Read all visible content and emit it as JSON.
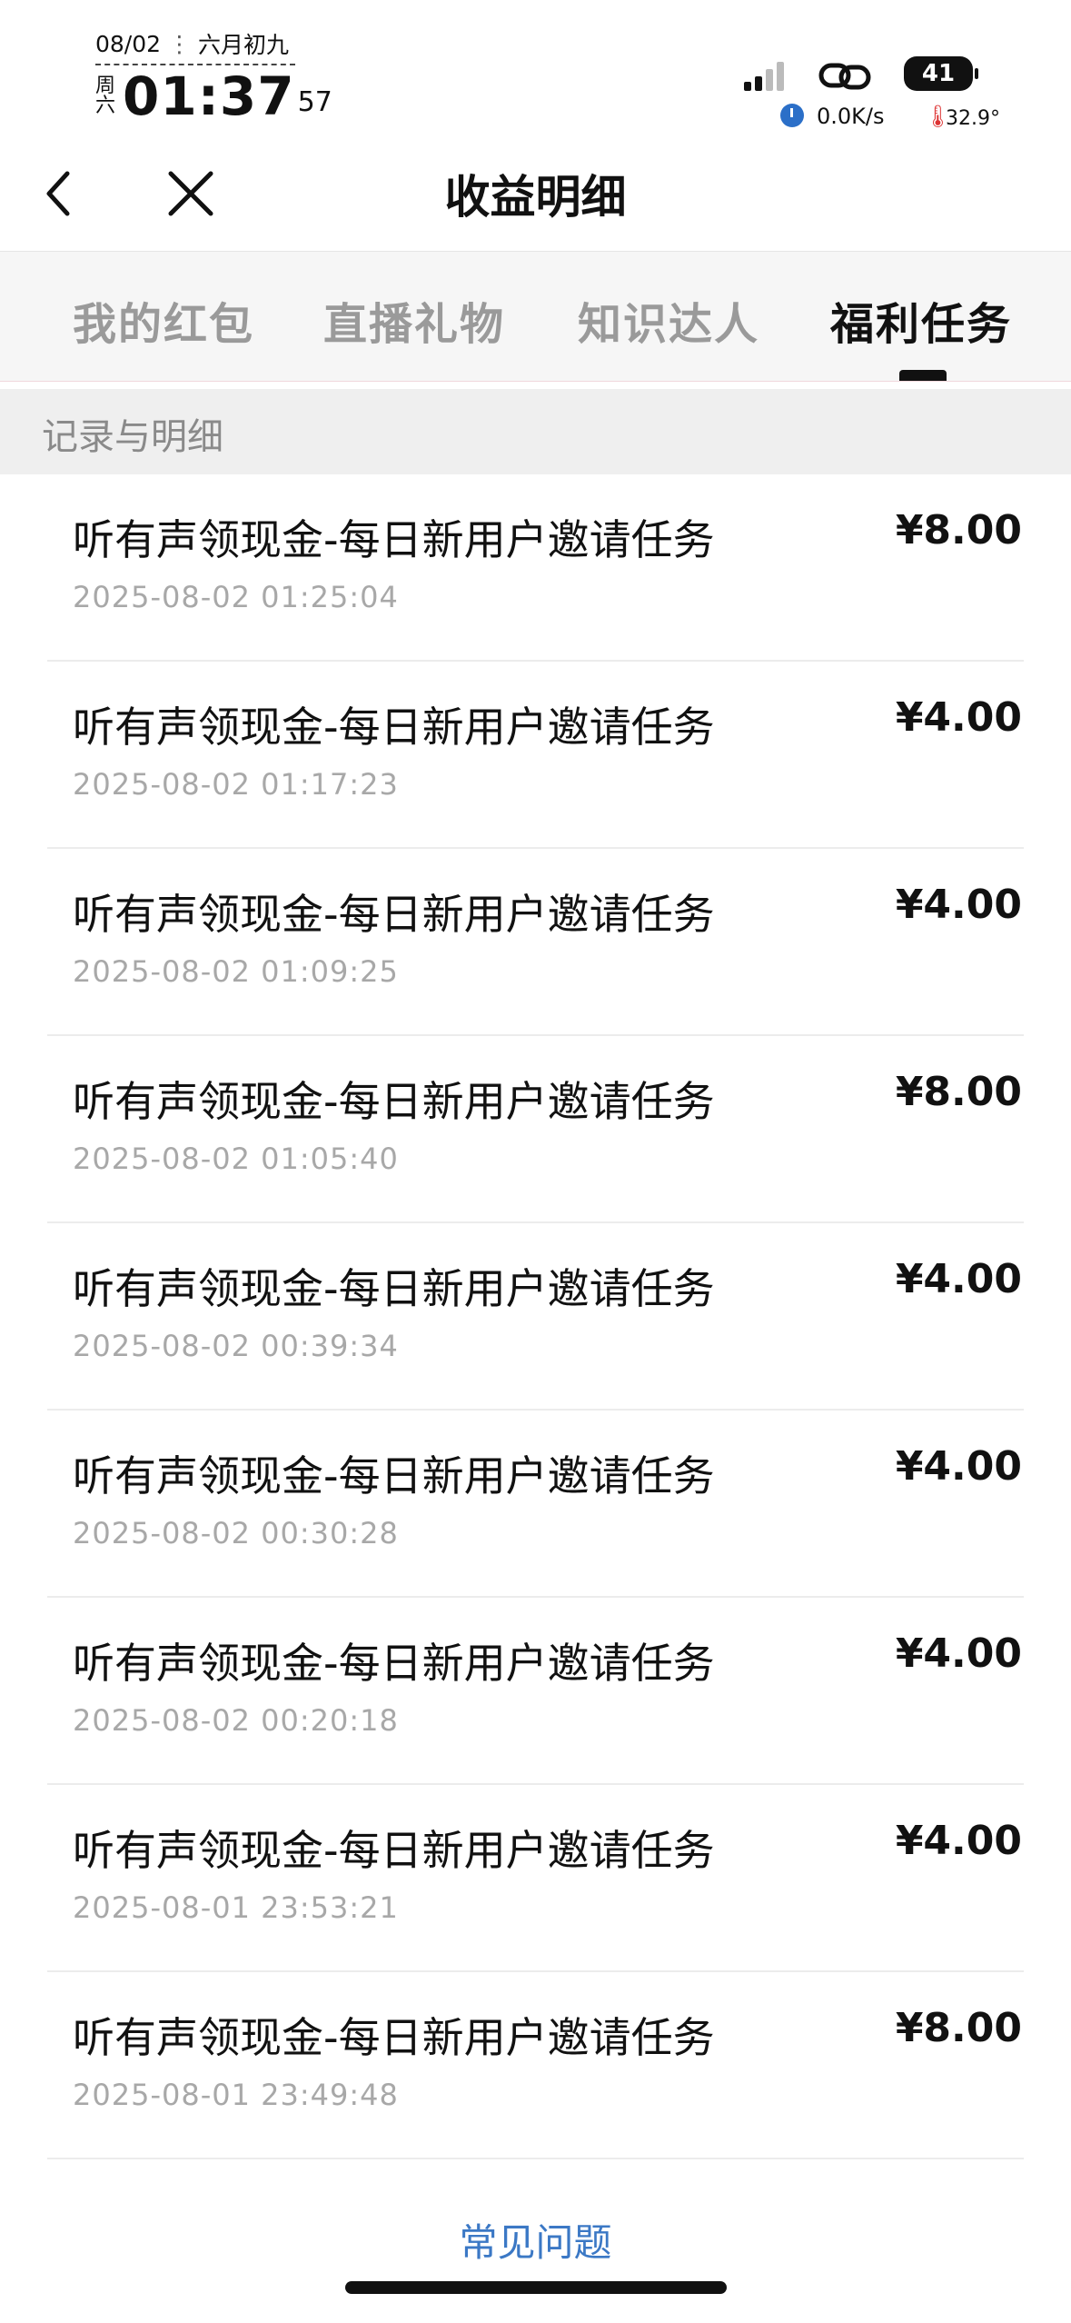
{
  "status_bar": {
    "date": "08/02",
    "lunar": "六月初九",
    "weekday_line1": "周",
    "weekday_line2": "六",
    "time": "01:37",
    "seconds": "57",
    "battery": "41",
    "net_speed": "0.0K/s",
    "temperature": "32.9°"
  },
  "nav": {
    "title": "收益明细",
    "back_icon": "chevron-left-icon",
    "close_icon": "close-icon"
  },
  "tabs": [
    {
      "label": "我的红包",
      "active": false
    },
    {
      "label": "直播礼物",
      "active": false
    },
    {
      "label": "知识达人",
      "active": false
    },
    {
      "label": "福利任务",
      "active": true
    }
  ],
  "section": {
    "header": "记录与明细"
  },
  "records": [
    {
      "title": "听有声领现金-每日新用户邀请任务",
      "time": "2025-08-02 01:25:04",
      "amount": "¥8.00"
    },
    {
      "title": "听有声领现金-每日新用户邀请任务",
      "time": "2025-08-02 01:17:23",
      "amount": "¥4.00"
    },
    {
      "title": "听有声领现金-每日新用户邀请任务",
      "time": "2025-08-02 01:09:25",
      "amount": "¥4.00"
    },
    {
      "title": "听有声领现金-每日新用户邀请任务",
      "time": "2025-08-02 01:05:40",
      "amount": "¥8.00"
    },
    {
      "title": "听有声领现金-每日新用户邀请任务",
      "time": "2025-08-02 00:39:34",
      "amount": "¥4.00"
    },
    {
      "title": "听有声领现金-每日新用户邀请任务",
      "time": "2025-08-02 00:30:28",
      "amount": "¥4.00"
    },
    {
      "title": "听有声领现金-每日新用户邀请任务",
      "time": "2025-08-02 00:20:18",
      "amount": "¥4.00"
    },
    {
      "title": "听有声领现金-每日新用户邀请任务",
      "time": "2025-08-01 23:53:21",
      "amount": "¥4.00"
    },
    {
      "title": "听有声领现金-每日新用户邀请任务",
      "time": "2025-08-01 23:49:48",
      "amount": "¥8.00"
    }
  ],
  "footer": {
    "faq": "常见问题"
  },
  "colors": {
    "link": "#3b78c5",
    "muted": "#a8a8a8",
    "active_tab": "#111111"
  }
}
